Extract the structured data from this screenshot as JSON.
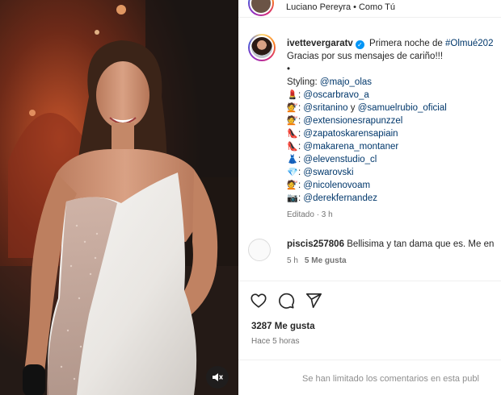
{
  "header": {
    "audio_artist": "Luciano Pereyra",
    "audio_separator": "•",
    "audio_title": "Como Tú"
  },
  "post": {
    "username": "ivettevergaratv",
    "caption_line1": "Primera noche de",
    "hashtag": "#Olmué202",
    "caption_line2": "Gracias por sus mensajes de cariño!!!",
    "bullet": "•",
    "styling_label": "Styling:",
    "credits": [
      {
        "icon": "lipstick-emoji",
        "glyph": "💄",
        "prefix": ":",
        "mention": "@oscarbravo_a",
        "extra": ""
      },
      {
        "icon": "woman-haircut-emoji",
        "glyph": "💇",
        "prefix": ":",
        "mention": "@sritanino",
        "extra": " y ",
        "mention2": "@samuelrubio_oficial"
      },
      {
        "icon": "woman-haircut-emoji",
        "glyph": "💇",
        "prefix": ":",
        "mention": "@extensionesrapunzzel",
        "extra": ""
      },
      {
        "icon": "high-heel-emoji",
        "glyph": "👠",
        "prefix": ":",
        "mention": "@zapatoskarensapiain",
        "extra": ""
      },
      {
        "icon": "high-heel-emoji",
        "glyph": "👠",
        "prefix": ":",
        "mention": "@makarena_montaner",
        "extra": ""
      },
      {
        "icon": "dress-emoji",
        "glyph": "👗",
        "prefix": ":",
        "mention": "@elevenstudio_cl",
        "extra": ""
      },
      {
        "icon": "diamond-emoji",
        "glyph": "💎",
        "prefix": ":",
        "mention": "@swarovski",
        "extra": ""
      },
      {
        "icon": "woman-haircut-emoji",
        "glyph": "💇",
        "prefix": ":",
        "mention": "@nicolenovoam",
        "extra": ""
      },
      {
        "icon": "camera-emoji",
        "glyph": "📷",
        "prefix": ":",
        "mention": "@derekfernandez",
        "extra": ""
      }
    ],
    "edited": "Editado · 3 h"
  },
  "comment": {
    "username": "piscis257806",
    "text": "Bellisima y tan dama que es. Me en",
    "time": "5 h",
    "likes": "5 Me gusta"
  },
  "actions": {
    "like_icon": "heart-icon",
    "comment_icon": "comment-icon",
    "share_icon": "send-icon"
  },
  "likes_count": "3287 Me gusta",
  "time_ago": "Hace 5 horas",
  "footer": {
    "limited_text": "Se han limitado los comentarios en esta publ"
  },
  "colors": {
    "link": "#00376b",
    "verified": "#0095f6",
    "muted": "#737373"
  }
}
